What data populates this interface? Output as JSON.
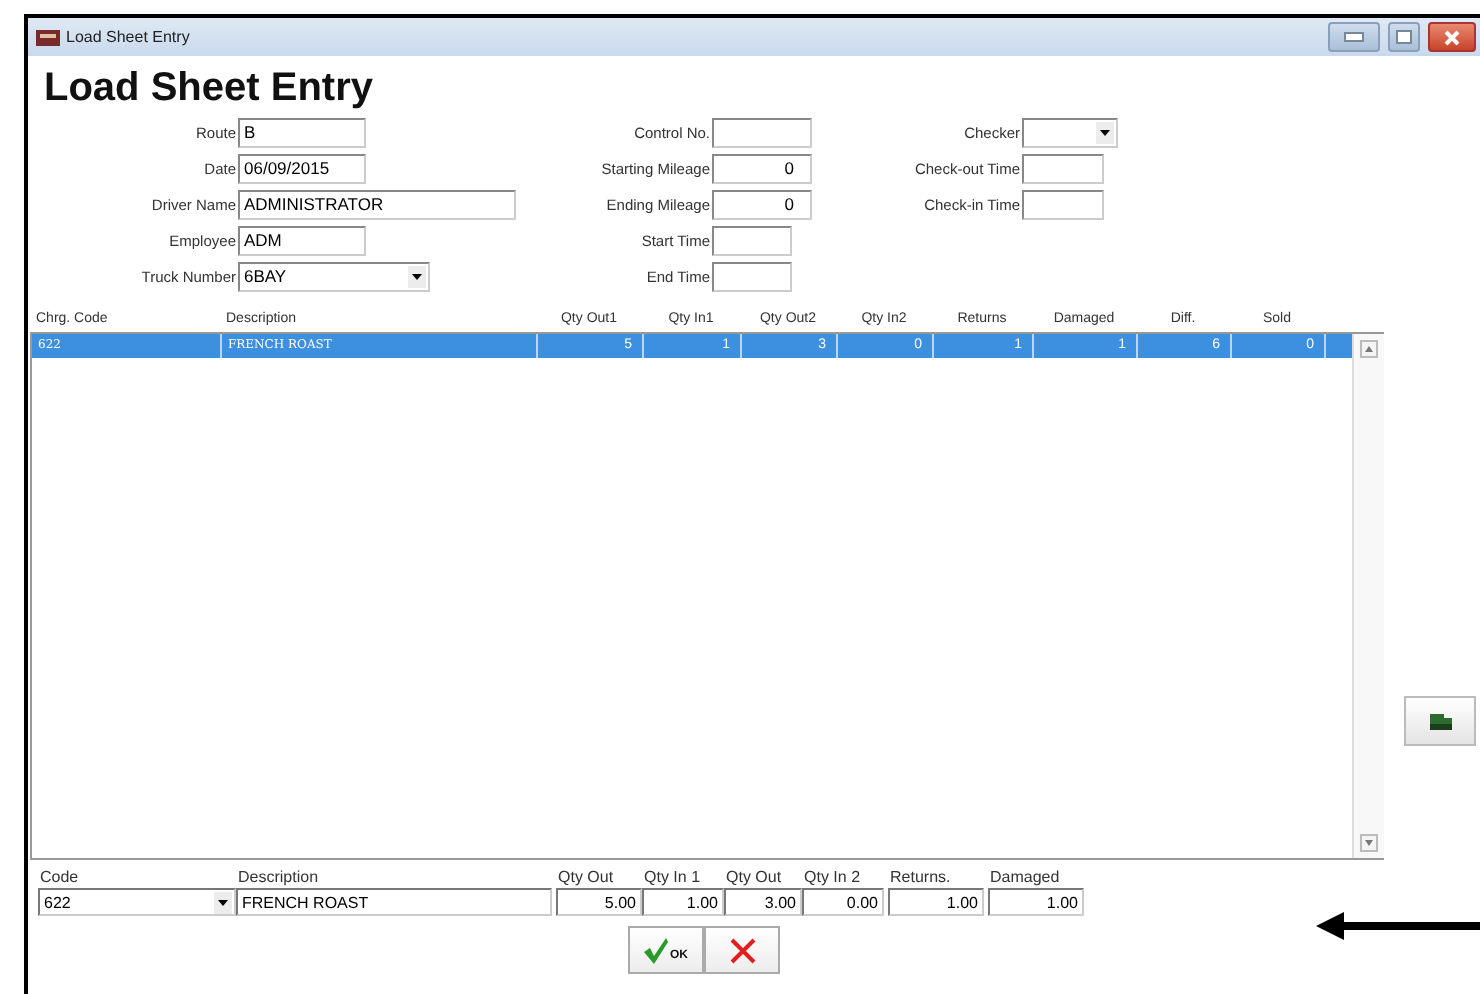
{
  "window": {
    "title": "Load Sheet Entry"
  },
  "heading": "Load Sheet Entry",
  "fields_left": [
    {
      "label": "Route",
      "value": "B",
      "kind": "text"
    },
    {
      "label": "Date",
      "value": "06/09/2015",
      "kind": "text"
    },
    {
      "label": "Driver Name",
      "value": "ADMINISTRATOR",
      "kind": "wide"
    },
    {
      "label": "Employee",
      "value": "ADM",
      "kind": "text"
    },
    {
      "label": "Truck Number",
      "value": "6BAY",
      "kind": "combo"
    }
  ],
  "fields_middle": [
    {
      "label": "Control No.",
      "kind": "text"
    },
    {
      "label": "Starting Mileage",
      "value": "0",
      "kind": "number"
    },
    {
      "label": "Ending Mileage",
      "value": "0",
      "kind": "number"
    },
    {
      "label": "Start Time",
      "kind": "short"
    },
    {
      "label": "End Time",
      "kind": "short"
    }
  ],
  "fields_right": [
    {
      "label": "Checker",
      "kind": "combo"
    },
    {
      "label": "Check-out Time",
      "kind": "text"
    },
    {
      "label": "Check-in Time",
      "kind": "text"
    }
  ],
  "grid": {
    "columns": [
      "Chrg. Code",
      "Description",
      "Qty Out1",
      "Qty In1",
      "Qty Out2",
      "Qty In2",
      "Returns",
      "Damaged",
      "Diff.",
      "Sold"
    ],
    "rows": [
      {
        "selected": true,
        "cells": [
          "622",
          "FRENCH ROAST",
          "5",
          "1",
          "3",
          "0",
          "1",
          "1",
          "6",
          "0"
        ]
      }
    ]
  },
  "entry": {
    "columns": [
      "Code",
      "Description",
      "Qty Out",
      "Qty In 1",
      "Qty Out",
      "Qty In 2",
      "Returns.",
      "Damaged"
    ],
    "values": [
      "622",
      "FRENCH ROAST",
      "5.00",
      "1.00",
      "3.00",
      "0.00",
      "1.00",
      "1.00"
    ]
  },
  "buttons": [
    {
      "kind": "ok",
      "label": "OK"
    },
    {
      "kind": "cancel"
    }
  ]
}
